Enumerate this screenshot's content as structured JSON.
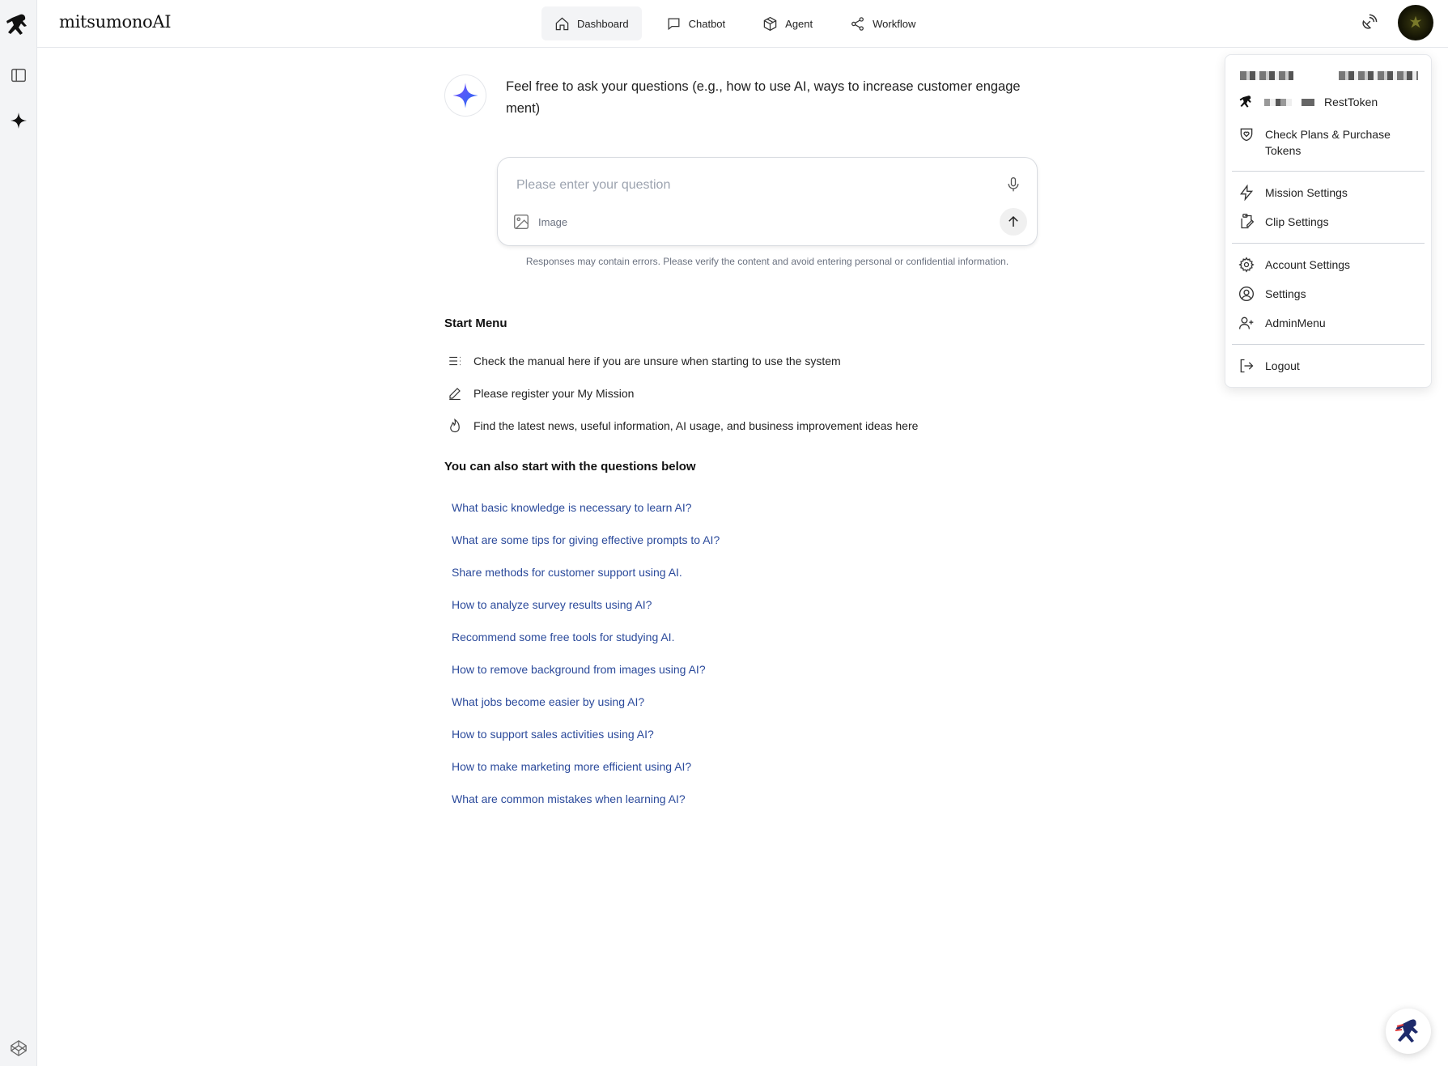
{
  "app": {
    "name": "mitsumonoAI"
  },
  "nav": {
    "items": [
      {
        "label": "Dashboard",
        "icon": "home-icon",
        "active": true
      },
      {
        "label": "Chatbot",
        "icon": "chat-icon",
        "active": false
      },
      {
        "label": "Agent",
        "icon": "cube-icon",
        "active": false
      },
      {
        "label": "Workflow",
        "icon": "share-icon",
        "active": false
      }
    ]
  },
  "welcome": {
    "text": "Feel free to ask your questions (e.g., how to use AI, ways to increase customer engage ment)"
  },
  "composer": {
    "placeholder": "Please enter your question",
    "image_label": "Image",
    "disclaimer": "Responses may contain errors. Please verify the content and avoid entering personal or confidential information."
  },
  "start_menu": {
    "title": "Start Menu",
    "items": [
      {
        "label": "Check the manual here if you are unsure when starting to use the system",
        "icon": "list-icon"
      },
      {
        "label": "Please register your My Mission",
        "icon": "pencil-icon"
      },
      {
        "label": "Find the latest news, useful information, AI usage, and business improvement ideas here",
        "icon": "flame-icon"
      }
    ]
  },
  "questions": {
    "title": "You can also start with the questions below",
    "items": [
      "What basic knowledge is necessary to learn AI?",
      "What are some tips for giving effective prompts to AI?",
      "Share methods for customer support using AI.",
      "How to analyze survey results using AI?",
      "Recommend some free tools for studying AI.",
      "How to remove background from images using AI?",
      "What jobs become easier by using AI?",
      "How to support sales activities using AI?",
      "How to make marketing more efficient using AI?",
      "What are common mistakes when learning AI?"
    ]
  },
  "user_menu": {
    "token_label": "RestToken",
    "plans": "Check Plans & Purchase Tokens",
    "mission_settings": "Mission Settings",
    "clip_settings": "Clip Settings",
    "account_settings": "Account Settings",
    "settings": "Settings",
    "admin_menu": "AdminMenu",
    "logout": "Logout"
  },
  "colors": {
    "link": "#2b4a9b",
    "accent_spark": "#3b6cf6"
  }
}
